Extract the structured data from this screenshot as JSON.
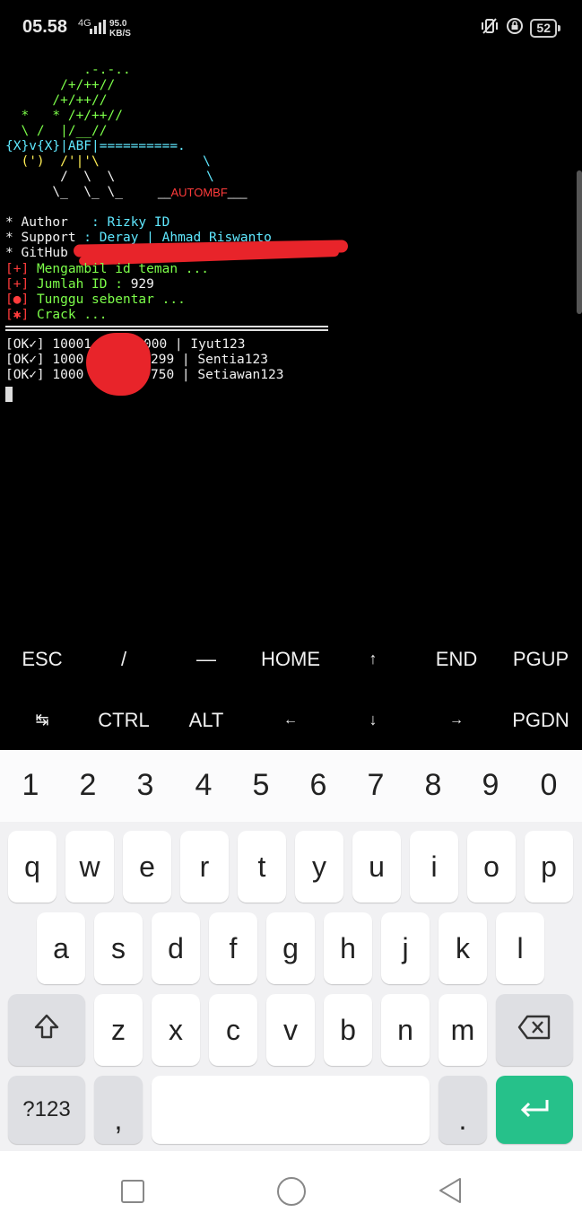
{
  "status_bar": {
    "time": "05.58",
    "network": "4G",
    "speed_value": "95.0",
    "speed_unit": "KB/S",
    "battery": "52"
  },
  "terminal": {
    "banner": [
      "          .-.-..",
      "       /+/++//",
      "      /+/++//",
      "  *   * /+/++//",
      "  \\ /  |/__//",
      "{X}v{X}|ABF|==========.",
      "  (')  /'|'\\",
      "       /  \\  \\",
      "      \\_  \\_ \\_"
    ],
    "automf_label": "AUTOMBF",
    "info": [
      {
        "bullet": "*",
        "key": "Author",
        "value": "Rizky ID"
      },
      {
        "bullet": "*",
        "key": "Support",
        "value": "Deray | Ahmad Riswanto"
      },
      {
        "bullet": "*",
        "key": "GitHub",
        "value": ""
      }
    ],
    "steps": [
      {
        "tag": "[+]",
        "text": "Mengambil id teman ..."
      },
      {
        "tag": "[+]",
        "text": "Jumlah ID : ",
        "count": "929"
      },
      {
        "tag": "[●]",
        "text": "Tunggu sebentar ..."
      },
      {
        "tag": "[✱]",
        "text": "Crack ..."
      }
    ],
    "results": [
      {
        "status": "[OK✓]",
        "id_start": "10001",
        "id_end": "000",
        "password": "Iyut123"
      },
      {
        "status": "[OK✓]",
        "id_start": "1000",
        "id_end": "299",
        "password": "Sentia123"
      },
      {
        "status": "[OK✓]",
        "id_start": "1000",
        "id_end": "750",
        "password": "Setiawan123"
      }
    ]
  },
  "extra_keys": {
    "row1": [
      "ESC",
      "/",
      "—",
      "HOME",
      "↑",
      "END",
      "PGUP"
    ],
    "row2": [
      "↹",
      "CTRL",
      "ALT",
      "←",
      "↓",
      "→",
      "PGDN"
    ]
  },
  "keyboard": {
    "numbers": [
      "1",
      "2",
      "3",
      "4",
      "5",
      "6",
      "7",
      "8",
      "9",
      "0"
    ],
    "row1": [
      "q",
      "w",
      "e",
      "r",
      "t",
      "y",
      "u",
      "i",
      "o",
      "p"
    ],
    "row2": [
      "a",
      "s",
      "d",
      "f",
      "g",
      "h",
      "j",
      "k",
      "l"
    ],
    "row3": [
      "z",
      "x",
      "c",
      "v",
      "b",
      "n",
      "m"
    ],
    "symbols_key": "?123",
    "comma_key": ",",
    "period_key": ".",
    "enter_color": "#26c18a"
  }
}
